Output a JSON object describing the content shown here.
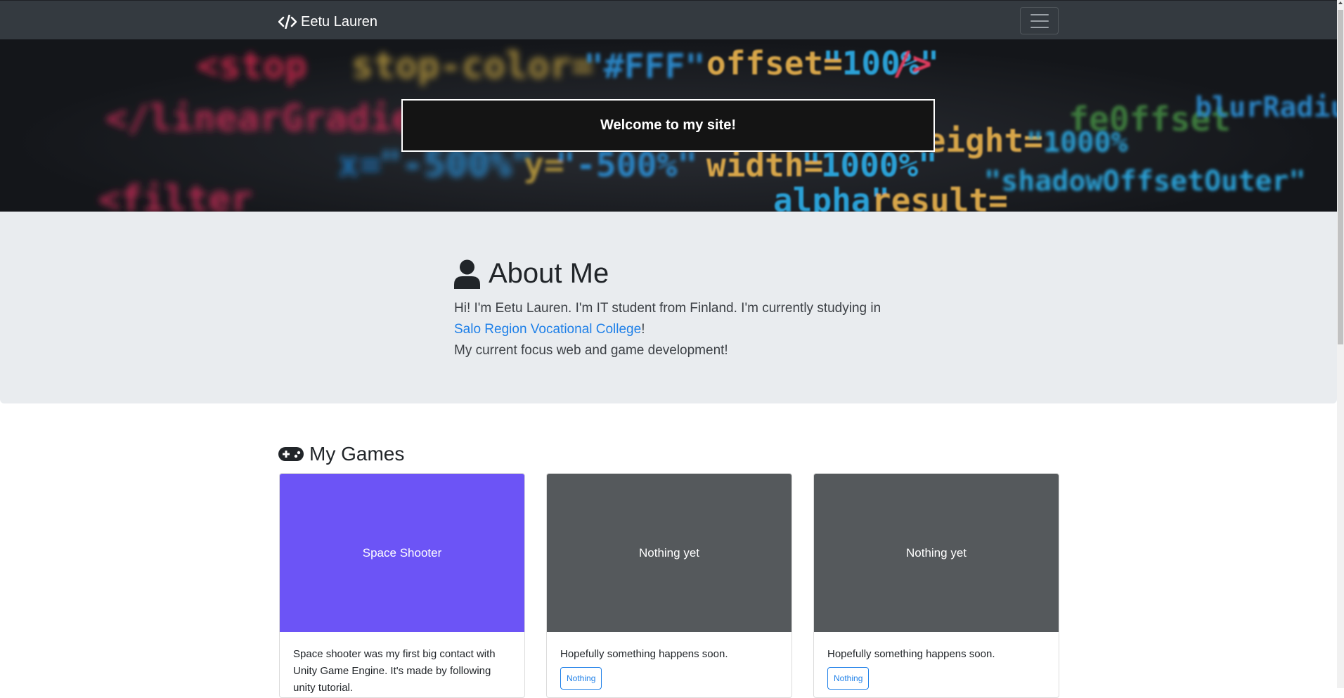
{
  "navbar": {
    "brand": "Eetu Lauren",
    "brand_icon": "code-icon",
    "toggler_icon": "hamburger-icon"
  },
  "hero": {
    "welcome": "Welcome to my site!"
  },
  "about": {
    "title": "About Me",
    "icon": "user-icon",
    "line1": "Hi! I'm Eetu Lauren. I'm IT student from Finland. I'm currently studying in",
    "link_text": "Salo Region Vocational College",
    "line2_suffix": "!",
    "line3": "My current focus web and game development!"
  },
  "games": {
    "title": "My Games",
    "icon": "gamepad-icon",
    "cards": [
      {
        "image_label": "Space Shooter",
        "image_color": "#6c54f6",
        "text": "Space shooter was my first big contact with Unity Game Engine. It's made by following unity tutorial.",
        "button": ""
      },
      {
        "image_label": "Nothing yet",
        "image_color": "#55595c",
        "text": "Hopefully something happens soon.",
        "button": "Nothing"
      },
      {
        "image_label": "Nothing yet",
        "image_color": "#55595c",
        "text": "Hopefully something happens soon.",
        "button": "Nothing"
      }
    ]
  },
  "colors": {
    "navbar_bg": "#343a40",
    "about_bg": "#e9ecef",
    "link": "#1f80e8"
  }
}
